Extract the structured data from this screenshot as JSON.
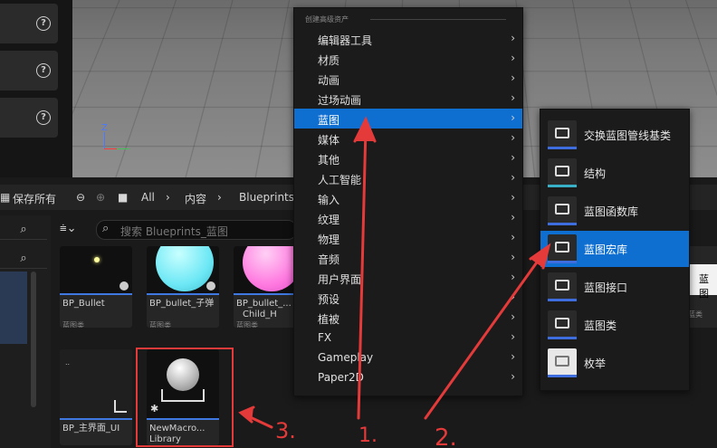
{
  "details_panel": {
    "help_glyph": "?"
  },
  "viewport": {
    "axis_z": "Z"
  },
  "toolbar": {
    "save_all": "保存所有",
    "breadcrumb": [
      "All",
      "内容",
      "Blueprints_"
    ]
  },
  "search": {
    "placeholder": "搜索 Blueprints_蓝图"
  },
  "assets": [
    {
      "name": "BP_Bullet",
      "type": "蓝图类"
    },
    {
      "name": "BP_bullet_子弹",
      "type": "蓝图类"
    },
    {
      "name": "BP_bullet_...",
      "name2": "Child_H",
      "type": "蓝图类"
    },
    {
      "name": "BP_主界面_UI",
      "type": ""
    },
    {
      "name": "NewMacro...",
      "name2": "Library",
      "type": ""
    }
  ],
  "right_partial": {
    "label": "蓝图",
    "type": "蓝类"
  },
  "menu": {
    "header": "创建高级资产",
    "items": [
      {
        "label": "编辑器工具",
        "active": false
      },
      {
        "label": "材质",
        "active": false
      },
      {
        "label": "动画",
        "active": false
      },
      {
        "label": "过场动画",
        "active": false
      },
      {
        "label": "蓝图",
        "active": true
      },
      {
        "label": "媒体",
        "active": false
      },
      {
        "label": "其他",
        "active": false
      },
      {
        "label": "人工智能",
        "active": false
      },
      {
        "label": "输入",
        "active": false
      },
      {
        "label": "纹理",
        "active": false
      },
      {
        "label": "物理",
        "active": false
      },
      {
        "label": "音频",
        "active": false
      },
      {
        "label": "用户界面",
        "active": false
      },
      {
        "label": "预设",
        "active": false
      },
      {
        "label": "植被",
        "active": false
      },
      {
        "label": "FX",
        "active": false
      },
      {
        "label": "Gameplay",
        "active": false
      },
      {
        "label": "Paper2D",
        "active": false
      }
    ],
    "chevron": "›"
  },
  "submenu": {
    "items": [
      {
        "label": "交换蓝图管线基类",
        "icon": "blueprint-node-icon",
        "active": false
      },
      {
        "label": "结构",
        "icon": "struct-icon",
        "active": false
      },
      {
        "label": "蓝图函数库",
        "icon": "function-library-icon",
        "active": false
      },
      {
        "label": "蓝图宏库",
        "icon": "macro-library-icon",
        "active": true
      },
      {
        "label": "蓝图接口",
        "icon": "interface-icon",
        "active": false
      },
      {
        "label": "蓝图类",
        "icon": "blueprint-class-icon",
        "active": false
      },
      {
        "label": "枚举",
        "icon": "enum-icon",
        "active": false
      }
    ]
  },
  "annotations": [
    "1.",
    "2.",
    "3."
  ],
  "colors": {
    "accent": "#0f6fd1",
    "annotation": "#e53a3a"
  }
}
